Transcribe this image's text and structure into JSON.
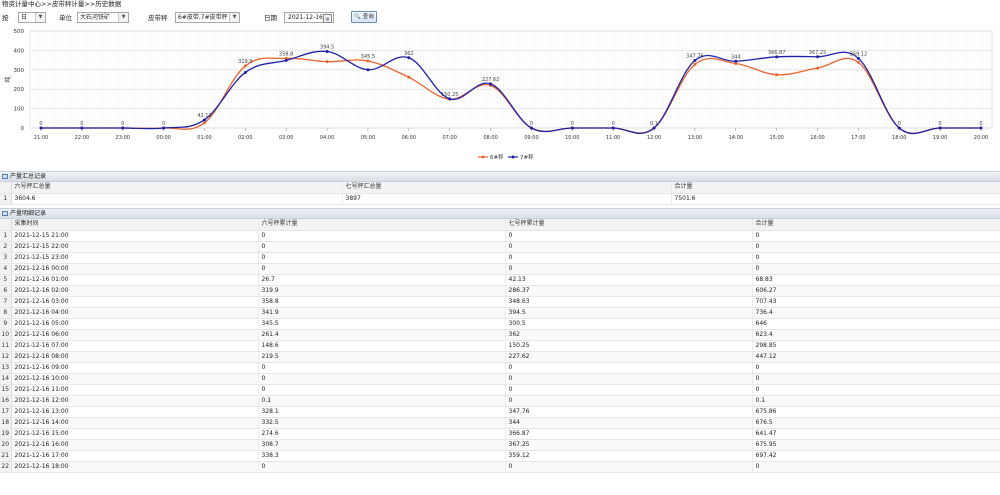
{
  "breadcrumb": "物资计量中心>>皮带秤计量>>历史数据",
  "toolbar": {
    "by_label": "按",
    "period_value": "日",
    "unit_label": "单位",
    "unit_value": "大石河铁矿",
    "scale_label": "皮带秤",
    "scale_value": "6#皮带,7#皮带秤",
    "date_label": "日期",
    "date_value": "2021-12-16",
    "query_label": "查询",
    "calendar_icon": "calendar-icon",
    "search_icon": "search-icon"
  },
  "chart_data": {
    "type": "line",
    "ylabel": "吨",
    "ylim": [
      0,
      500
    ],
    "yticks": [
      0,
      100,
      200,
      300,
      400,
      500
    ],
    "grid": true,
    "legend_position": "bottom-center",
    "categories": [
      "21:00",
      "22:00",
      "23:00",
      "00:00",
      "01:00",
      "02:00",
      "03:00",
      "04:00",
      "05:00",
      "06:00",
      "07:00",
      "08:00",
      "09:00",
      "10:00",
      "11:00",
      "12:00",
      "13:00",
      "14:00",
      "15:00",
      "16:00",
      "17:00",
      "18:00",
      "19:00",
      "20:00"
    ],
    "series": [
      {
        "name": "6#秤",
        "color": "#e8642c",
        "values": [
          0,
          0,
          0,
          0,
          26.7,
          319.9,
          358.8,
          341.9,
          345.5,
          261.4,
          148.6,
          219.5,
          0,
          0,
          0,
          0.1,
          328.1,
          332.5,
          274.6,
          308.7,
          338.3,
          0,
          0,
          0
        ]
      },
      {
        "name": "7#秤",
        "color": "#1f1fa8",
        "values": [
          0,
          0,
          0,
          0,
          42.13,
          286.37,
          348.63,
          394.5,
          300.5,
          362,
          150.25,
          227.62,
          0,
          0,
          0,
          0,
          347.76,
          344,
          366.87,
          367.25,
          359.12,
          0,
          0,
          0
        ]
      }
    ],
    "point_labels": [
      "0",
      "0",
      "0",
      "0",
      "42.13",
      "319.9",
      "358.8",
      "394.5",
      "345.5",
      "362",
      "150.25",
      "227.62",
      "0",
      "0",
      "0",
      "0.1",
      "347.76",
      "344",
      "366.87",
      "367.25",
      "359.12",
      "0",
      "0",
      "0"
    ]
  },
  "summary": {
    "title": "产量汇总记录",
    "icon": "table-icon",
    "columns": [
      "六号秤汇总量",
      "七号秤汇总量",
      "合计量"
    ],
    "rows": [
      {
        "n": "1",
        "c": [
          "3604.6",
          "3897",
          "7501.6"
        ]
      }
    ]
  },
  "detail": {
    "title": "产量明细记录",
    "icon": "table-icon",
    "columns": [
      "采集时间",
      "六号秤累计量",
      "七号秤累计量",
      "合计量"
    ],
    "rows": [
      {
        "n": "1",
        "c": [
          "2021-12-15 21:00",
          "0",
          "0",
          "0"
        ]
      },
      {
        "n": "2",
        "c": [
          "2021-12-15 22:00",
          "0",
          "0",
          "0"
        ]
      },
      {
        "n": "3",
        "c": [
          "2021-12-15 23:00",
          "0",
          "0",
          "0"
        ]
      },
      {
        "n": "4",
        "c": [
          "2021-12-16 00:00",
          "0",
          "0",
          "0"
        ]
      },
      {
        "n": "5",
        "c": [
          "2021-12-16 01:00",
          "26.7",
          "42.13",
          "68.83"
        ]
      },
      {
        "n": "6",
        "c": [
          "2021-12-16 02:00",
          "319.9",
          "286.37",
          "606.27"
        ]
      },
      {
        "n": "7",
        "c": [
          "2021-12-16 03:00",
          "358.8",
          "348.63",
          "707.43"
        ]
      },
      {
        "n": "8",
        "c": [
          "2021-12-16 04:00",
          "341.9",
          "394.5",
          "736.4"
        ]
      },
      {
        "n": "9",
        "c": [
          "2021-12-16 05:00",
          "345.5",
          "300.5",
          "646"
        ]
      },
      {
        "n": "10",
        "c": [
          "2021-12-16 06:00",
          "261.4",
          "362",
          "623.4"
        ]
      },
      {
        "n": "11",
        "c": [
          "2021-12-16 07:00",
          "148.6",
          "150.25",
          "298.85"
        ]
      },
      {
        "n": "12",
        "c": [
          "2021-12-16 08:00",
          "219.5",
          "227.62",
          "447.12"
        ]
      },
      {
        "n": "13",
        "c": [
          "2021-12-16 09:00",
          "0",
          "0",
          "0"
        ]
      },
      {
        "n": "14",
        "c": [
          "2021-12-16 10:00",
          "0",
          "0",
          "0"
        ]
      },
      {
        "n": "15",
        "c": [
          "2021-12-16 11:00",
          "0",
          "0",
          "0"
        ]
      },
      {
        "n": "16",
        "c": [
          "2021-12-16 12:00",
          "0.1",
          "0",
          "0.1"
        ]
      },
      {
        "n": "17",
        "c": [
          "2021-12-16 13:00",
          "328.1",
          "347.76",
          "675.86"
        ]
      },
      {
        "n": "18",
        "c": [
          "2021-12-16 14:00",
          "332.5",
          "344",
          "676.5"
        ]
      },
      {
        "n": "19",
        "c": [
          "2021-12-16 15:00",
          "274.6",
          "366.87",
          "641.47"
        ]
      },
      {
        "n": "20",
        "c": [
          "2021-12-16 16:00",
          "308.7",
          "367.25",
          "675.95"
        ]
      },
      {
        "n": "21",
        "c": [
          "2021-12-16 17:00",
          "338.3",
          "359.12",
          "697.42"
        ]
      },
      {
        "n": "22",
        "c": [
          "2021-12-16 18:00",
          "0",
          "0",
          "0"
        ]
      }
    ]
  }
}
